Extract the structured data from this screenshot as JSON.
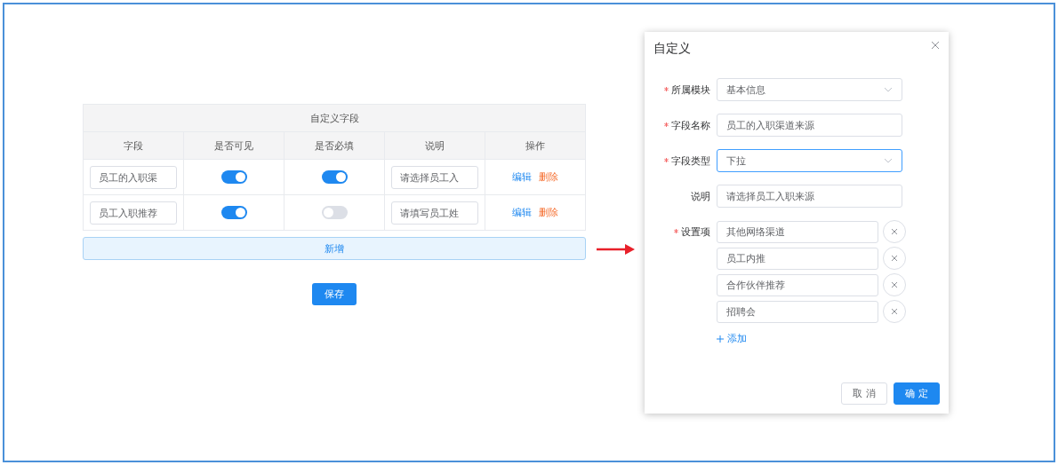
{
  "table": {
    "title": "自定义字段",
    "columns": [
      "字段",
      "是否可见",
      "是否必填",
      "说明",
      "操作"
    ],
    "rows": [
      {
        "field": "员工的入职渠",
        "visible": true,
        "required": true,
        "description": "请选择员工入",
        "actions": [
          {
            "label": "编辑",
            "kind": "edit"
          },
          {
            "label": "删除",
            "kind": "delete"
          }
        ]
      },
      {
        "field": "员工入职推荐",
        "visible": true,
        "required": false,
        "description": "请填写员工姓",
        "actions": [
          {
            "label": "编辑",
            "kind": "edit"
          },
          {
            "label": "删除",
            "kind": "delete"
          }
        ]
      }
    ]
  },
  "add_button": "新增",
  "save_button": "保存",
  "dialog": {
    "title": "自定义",
    "form": [
      {
        "kind": "select",
        "label": "所属模块",
        "required": true,
        "value": "基本信息",
        "focused": false
      },
      {
        "kind": "input",
        "label": "字段名称",
        "required": true,
        "value": "员工的入职渠道来源",
        "focused": false
      },
      {
        "kind": "select",
        "label": "字段类型",
        "required": true,
        "value": "下拉",
        "focused": true
      },
      {
        "kind": "input",
        "label": "说明",
        "required": false,
        "value": "请选择员工入职来源",
        "focused": false
      },
      {
        "kind": "options",
        "label": "设置项",
        "required": true,
        "options": [
          "其他网络渠道",
          "员工内推",
          "合作伙伴推荐",
          "招聘会"
        ],
        "add_link": "添加"
      }
    ],
    "buttons": [
      {
        "label": "取 消",
        "primary": false
      },
      {
        "label": "确 定",
        "primary": true
      }
    ]
  }
}
